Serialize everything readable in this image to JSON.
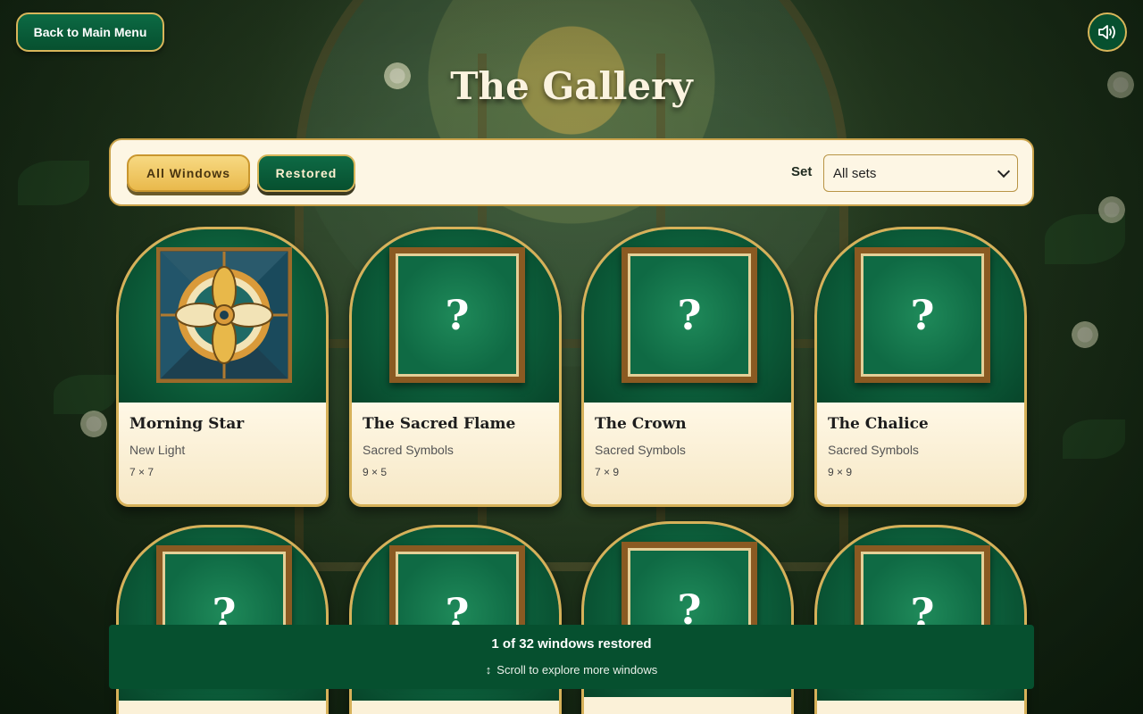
{
  "header": {
    "back_label": "Back to Main Menu",
    "title": "The Gallery"
  },
  "filters": {
    "all_label": "All Windows",
    "restored_label": "Restored",
    "set_label": "Set",
    "set_selected": "All sets"
  },
  "windows": [
    {
      "name": "Morning Star",
      "set": "New Light",
      "dims": "7 × 7",
      "restored": true
    },
    {
      "name": "The Sacred Flame",
      "set": "Sacred Symbols",
      "dims": "9 × 5",
      "restored": false
    },
    {
      "name": "The Crown",
      "set": "Sacred Symbols",
      "dims": "7 × 9",
      "restored": false
    },
    {
      "name": "The Chalice",
      "set": "Sacred Symbols",
      "dims": "9 × 9",
      "restored": false
    },
    {
      "name": "",
      "set": "",
      "dims": "",
      "restored": false
    },
    {
      "name": "",
      "set": "",
      "dims": "",
      "restored": false
    },
    {
      "name": "",
      "set": "",
      "dims": "",
      "restored": false
    },
    {
      "name": "",
      "set": "",
      "dims": "",
      "restored": false
    }
  ],
  "locked_symbol": "?",
  "status": {
    "summary": "1 of 32 windows restored",
    "hint_icon": "↕",
    "hint": "Scroll to explore more windows"
  },
  "icons": {
    "sound": "speaker-icon"
  },
  "colors": {
    "accent_gold": "#d6b159",
    "deep_green": "#07502f",
    "cream": "#fdf6e4"
  }
}
